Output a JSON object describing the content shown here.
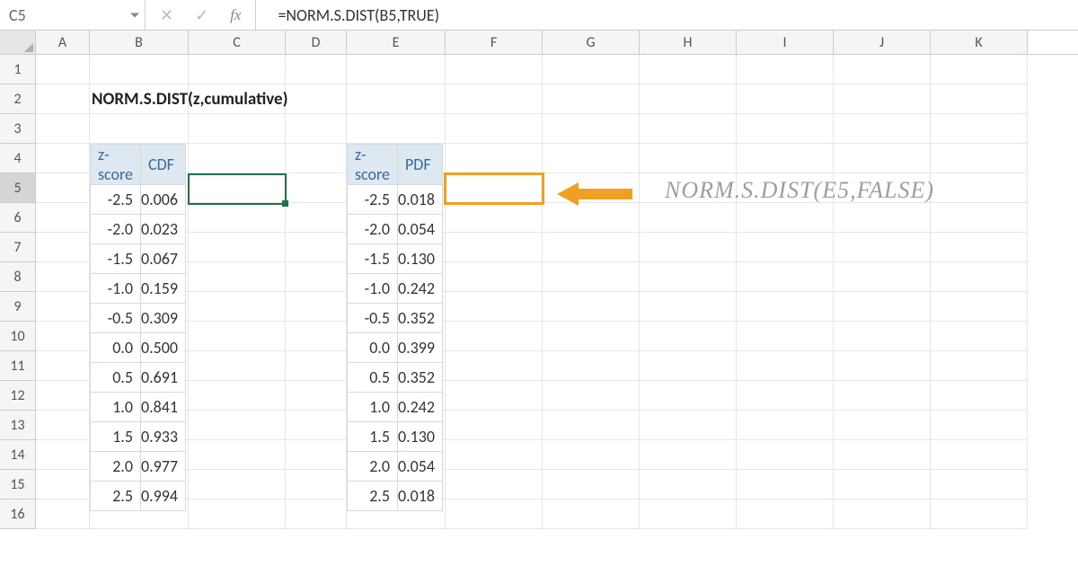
{
  "name_box": "C5",
  "formula": "=NORM.S.DIST(B5,TRUE)",
  "content_title": "NORM.S.DIST(z,cumulative)",
  "annotation": "NORM.S.DIST(E5,FALSE)",
  "columns": [
    "A",
    "B",
    "C",
    "D",
    "E",
    "F",
    "G",
    "H",
    "I",
    "J",
    "K"
  ],
  "rows": [
    "1",
    "2",
    "3",
    "4",
    "5",
    "6",
    "7",
    "8",
    "9",
    "10",
    "11",
    "12",
    "13",
    "14",
    "15",
    "16"
  ],
  "active_row": "5",
  "col_widths": {
    "A": 60,
    "B": 110,
    "C": 108,
    "D": 68,
    "E": 110,
    "F": 108,
    "G": 108,
    "H": 108,
    "I": 108,
    "J": 108,
    "K": 108
  },
  "table1": {
    "headers": [
      "z-score",
      "CDF"
    ],
    "rows": [
      [
        "-2.5",
        "0.006"
      ],
      [
        "-2.0",
        "0.023"
      ],
      [
        "-1.5",
        "0.067"
      ],
      [
        "-1.0",
        "0.159"
      ],
      [
        "-0.5",
        "0.309"
      ],
      [
        "0.0",
        "0.500"
      ],
      [
        "0.5",
        "0.691"
      ],
      [
        "1.0",
        "0.841"
      ],
      [
        "1.5",
        "0.933"
      ],
      [
        "2.0",
        "0.977"
      ],
      [
        "2.5",
        "0.994"
      ]
    ]
  },
  "table2": {
    "headers": [
      "z-score",
      "PDF"
    ],
    "rows": [
      [
        "-2.5",
        "0.018"
      ],
      [
        "-2.0",
        "0.054"
      ],
      [
        "-1.5",
        "0.130"
      ],
      [
        "-1.0",
        "0.242"
      ],
      [
        "-0.5",
        "0.352"
      ],
      [
        "0.0",
        "0.399"
      ],
      [
        "0.5",
        "0.352"
      ],
      [
        "1.0",
        "0.242"
      ],
      [
        "1.5",
        "0.130"
      ],
      [
        "2.0",
        "0.054"
      ],
      [
        "2.5",
        "0.018"
      ]
    ]
  },
  "colors": {
    "active_border": "#1f7246",
    "highlight_border": "#f0a020",
    "header_fill": "#dde8f1",
    "header_text": "#3a6a9b"
  }
}
